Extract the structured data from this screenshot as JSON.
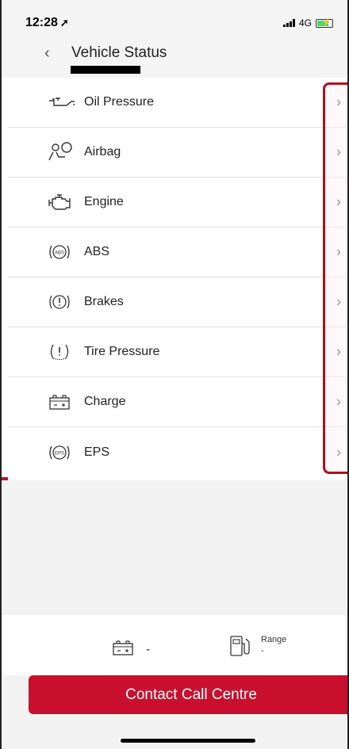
{
  "status_bar": {
    "time": "12:28",
    "time_arrow": "➚",
    "network": "4G"
  },
  "header": {
    "back_icon": "‹",
    "title": "Vehicle Status"
  },
  "list": {
    "items": [
      {
        "label": "Oil Pressure",
        "icon": "oil-pressure-icon"
      },
      {
        "label": "Airbag",
        "icon": "airbag-icon"
      },
      {
        "label": "Engine",
        "icon": "engine-icon"
      },
      {
        "label": "ABS",
        "icon": "abs-icon"
      },
      {
        "label": "Brakes",
        "icon": "brakes-icon"
      },
      {
        "label": "Tire Pressure",
        "icon": "tire-pressure-icon"
      },
      {
        "label": "Charge",
        "icon": "charge-icon"
      },
      {
        "label": "EPS",
        "icon": "eps-icon"
      }
    ],
    "chevron": "›",
    "accent_color": "#c8102e"
  },
  "bottom": {
    "battery_value": "-",
    "range_label": "Range",
    "range_value": "-"
  },
  "cta": {
    "label": "Contact Call Centre",
    "color": "#c8102e"
  }
}
